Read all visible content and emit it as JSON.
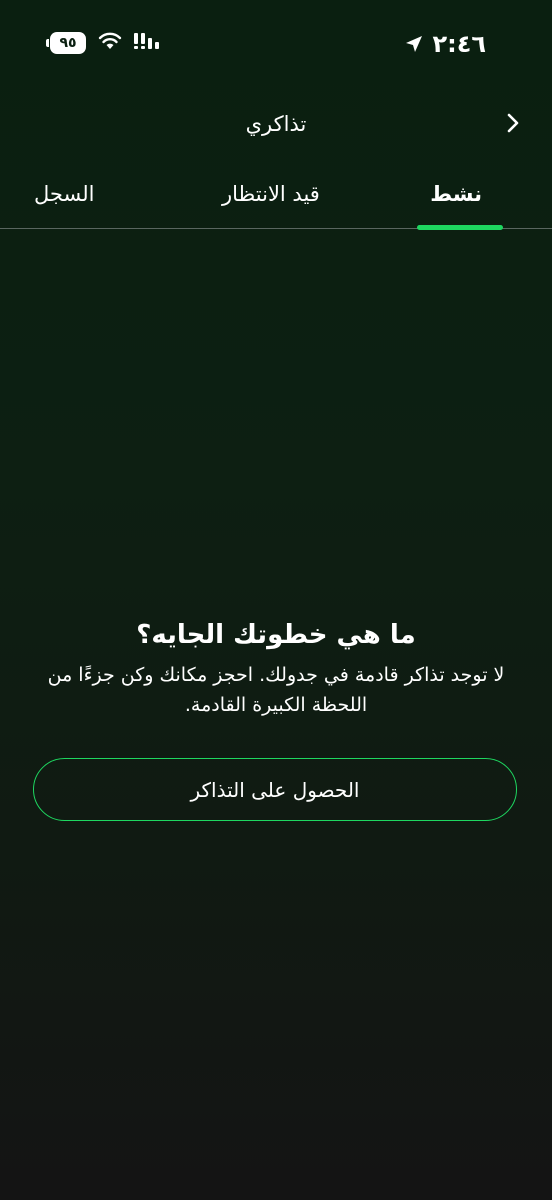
{
  "status_bar": {
    "time": "٢:٤٦",
    "battery": "٩٥",
    "icons": [
      "location-arrow-icon",
      "wifi-icon",
      "signal-icon",
      "battery-icon"
    ]
  },
  "header": {
    "title": "تذاكري",
    "back_icon": "chevron-right-icon"
  },
  "tabs": [
    {
      "label": "نشط",
      "active": true
    },
    {
      "label": "قيد الانتظار",
      "active": false
    },
    {
      "label": "السجل",
      "active": false
    }
  ],
  "empty_state": {
    "title": "ما هي خطوتك الجايه؟",
    "message": "لا توجد تذاكر قادمة في جدولك. احجز مكانك وكن جزءًا من اللحظة الكبيرة القادمة.",
    "button_label": "الحصول على التذاكر"
  },
  "colors": {
    "accent": "#1ed760",
    "background_top": "#0a1f10",
    "background_bottom": "#141414",
    "text": "#ffffff"
  }
}
